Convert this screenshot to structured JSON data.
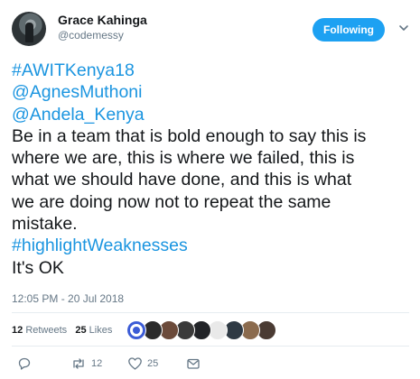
{
  "author": {
    "name": "Grace Kahinga",
    "handle": "@codemessy"
  },
  "follow_button": {
    "label": "Following"
  },
  "tweet": {
    "lines": [
      {
        "text": "#AWITKenya18",
        "kind": "link"
      },
      {
        "text": "@AgnesMuthoni",
        "kind": "link"
      },
      {
        "text": "@Andela_Kenya",
        "kind": "link"
      },
      {
        "text": "Be in a team that is bold enough to say this is",
        "kind": "text"
      },
      {
        "text": "where we are, this is where we failed, this is",
        "kind": "text"
      },
      {
        "text": "what we should have done, and this is what",
        "kind": "text"
      },
      {
        "text": "we are doing now not to repeat the same",
        "kind": "text"
      },
      {
        "text": "mistake.",
        "kind": "text"
      },
      {
        "text": "#highlightWeaknesses",
        "kind": "link"
      },
      {
        "text": "It's OK",
        "kind": "text"
      }
    ]
  },
  "timestamp": "12:05 PM - 20 Jul 2018",
  "stats": {
    "retweets_count": "12",
    "retweets_label": "Retweets",
    "likes_count": "25",
    "likes_label": "Likes"
  },
  "actions": {
    "reply_count": "",
    "retweet_count": "12",
    "like_count": "25"
  },
  "colors": {
    "link": "#1b95e0",
    "follow_button": "#1da1f2",
    "muted": "#657786",
    "divider": "#e6ecf0"
  },
  "icons": [
    "chevron-down-icon",
    "reply-icon",
    "retweet-icon",
    "like-icon",
    "direct-message-icon"
  ],
  "likers": [
    {
      "name": "liker-avatar-1",
      "color": "#3b5bd6"
    },
    {
      "name": "liker-avatar-2",
      "color": "#2b2b2b"
    },
    {
      "name": "liker-avatar-3",
      "color": "#6b4a3a"
    },
    {
      "name": "liker-avatar-4",
      "color": "#3a3a3a"
    },
    {
      "name": "liker-avatar-5",
      "color": "#222428"
    },
    {
      "name": "liker-avatar-6",
      "color": "#e9e9e9"
    },
    {
      "name": "liker-avatar-7",
      "color": "#2f3a44"
    },
    {
      "name": "liker-avatar-8",
      "color": "#8b6b4e"
    },
    {
      "name": "liker-avatar-9",
      "color": "#4a3b33"
    }
  ]
}
